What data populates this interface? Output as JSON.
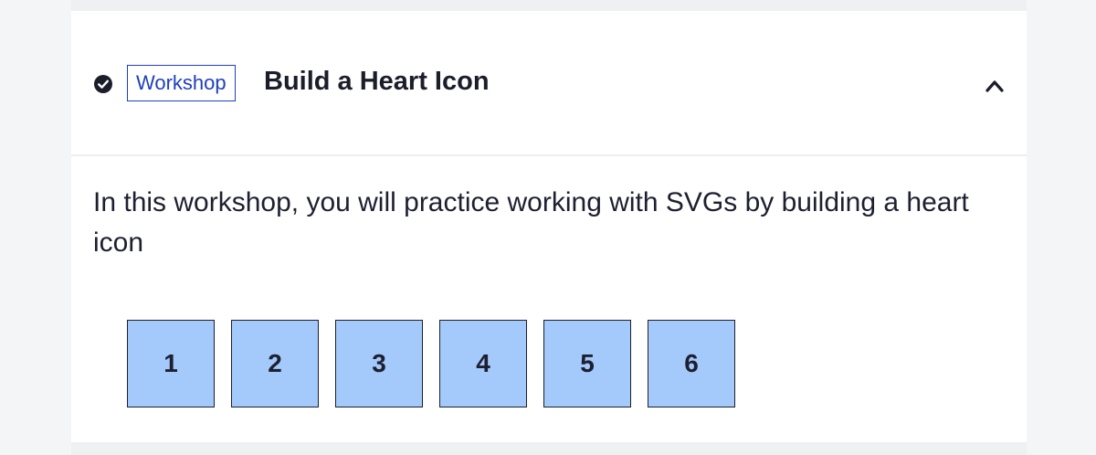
{
  "section": {
    "badge": "Workshop",
    "title": "Build a Heart Icon",
    "description": "In this workshop, you will practice working with SVGs by building a heart icon",
    "status_icon": "check-circle-icon",
    "toggle_icon": "chevron-up-icon"
  },
  "steps": [
    "1",
    "2",
    "3",
    "4",
    "5",
    "6"
  ],
  "colors": {
    "badge": "#1f3fbf",
    "step_fill": "#a4c9fb",
    "text": "#1b1d2a"
  }
}
